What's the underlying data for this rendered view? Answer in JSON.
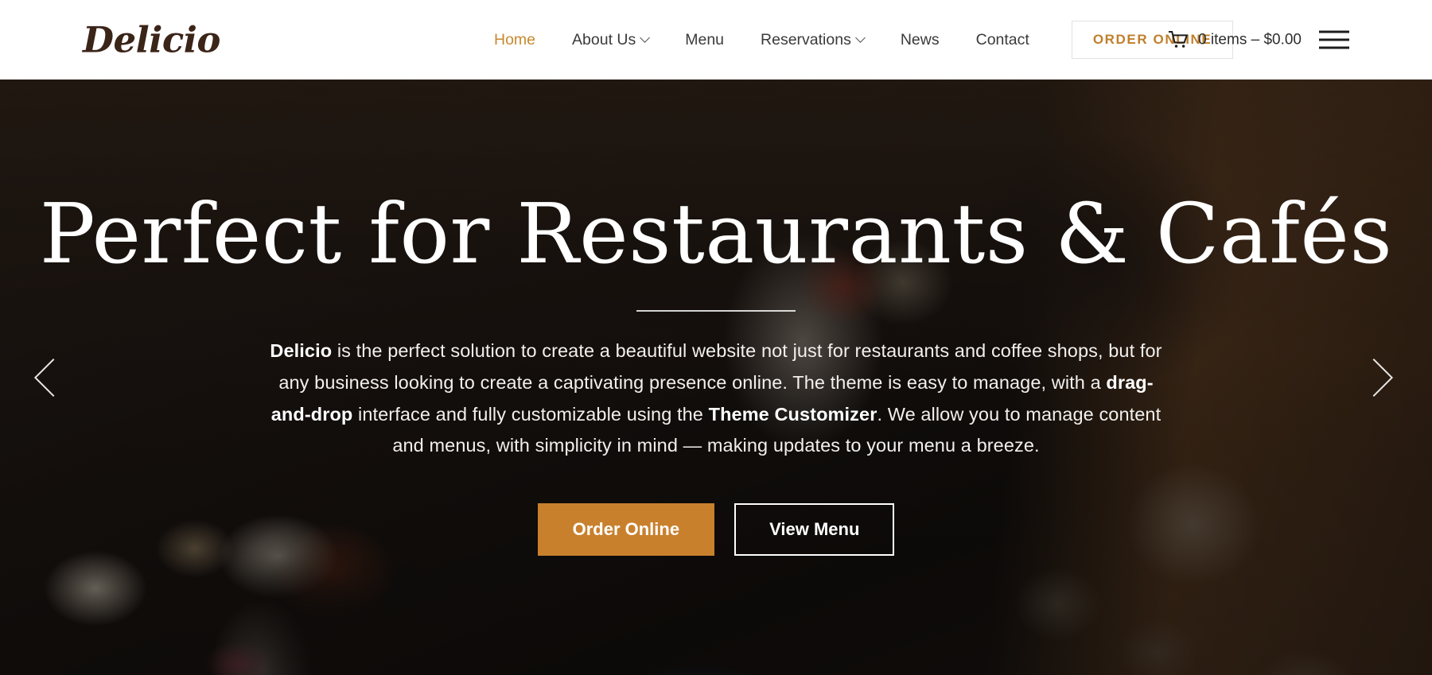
{
  "header": {
    "logo": "Delicio",
    "nav": [
      {
        "label": "Home",
        "active": true,
        "has_dropdown": false
      },
      {
        "label": "About Us",
        "active": false,
        "has_dropdown": true
      },
      {
        "label": "Menu",
        "active": false,
        "has_dropdown": false
      },
      {
        "label": "Reservations",
        "active": false,
        "has_dropdown": true
      },
      {
        "label": "News",
        "active": false,
        "has_dropdown": false
      },
      {
        "label": "Contact",
        "active": false,
        "has_dropdown": false
      }
    ],
    "order_button": "ORDER ONLINE",
    "cart": {
      "icon": "shopping-cart-icon",
      "text": "0 items – $0.00",
      "items": 0,
      "total": "$0.00"
    },
    "menu_toggle_icon": "hamburger-menu-icon"
  },
  "hero": {
    "title": "Perfect for Restaurants & Cafés",
    "paragraph_parts": [
      {
        "text": "Delicio",
        "bold": true
      },
      {
        "text": " is the perfect solution to create a beautiful website not just for restaurants and coffee shops, but for any business looking to create a captivating presence online. The theme is easy to manage, with a ",
        "bold": false
      },
      {
        "text": "drag-and-drop",
        "bold": true
      },
      {
        "text": " interface and fully customizable using the ",
        "bold": false
      },
      {
        "text": "Theme Customizer",
        "bold": true
      },
      {
        "text": ". We allow you to manage content and menus, with simplicity in mind — making updates to your menu a breeze.",
        "bold": false
      }
    ],
    "primary_button": "Order Online",
    "secondary_button": "View Menu",
    "prev_icon": "chevron-left-icon",
    "next_icon": "chevron-right-icon"
  },
  "colors": {
    "accent": "#c9802d",
    "nav_active": "#c8892f",
    "logo": "#3b2418",
    "header_bg": "#ffffff",
    "hero_text": "#ffffff"
  }
}
